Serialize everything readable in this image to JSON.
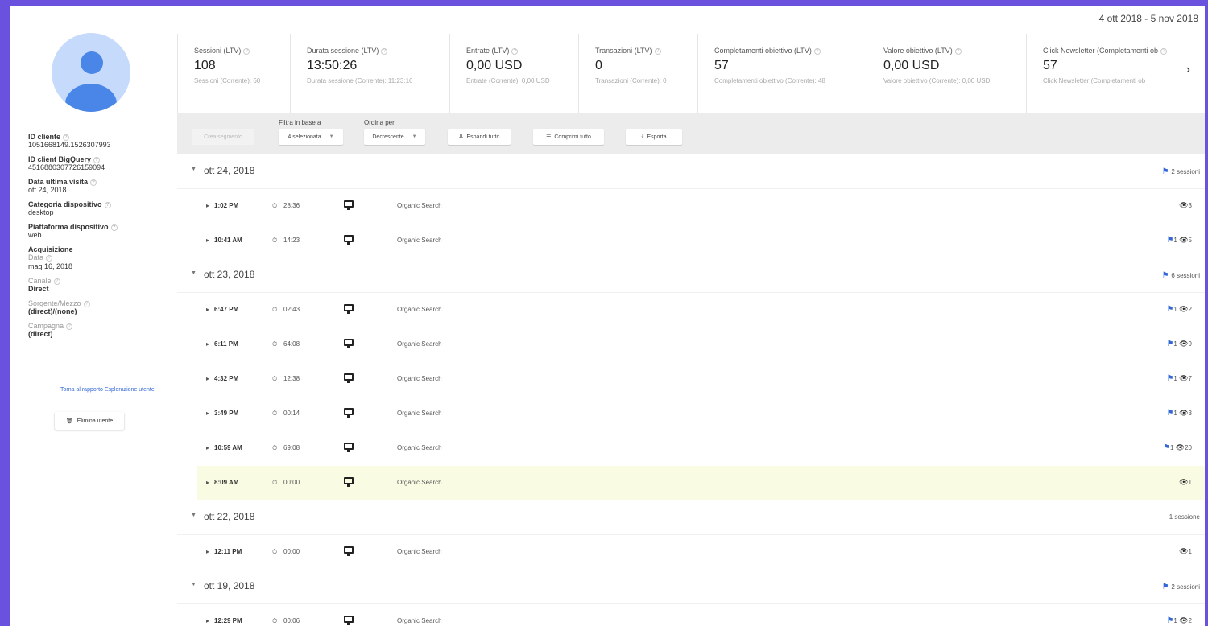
{
  "date_range": "4 ott 2018 - 5 nov 2018",
  "sidebar": {
    "fields": [
      {
        "label": "ID cliente",
        "value": "1051668149.1526307993"
      },
      {
        "label": "ID client BigQuery",
        "value": "4516880307726159094"
      },
      {
        "label": "Data ultima visita",
        "value": "ott 24, 2018"
      },
      {
        "label": "Categoria dispositivo",
        "value": "desktop"
      },
      {
        "label": "Piattaforma dispositivo",
        "value": "web"
      }
    ],
    "acquisition": {
      "label": "Acquisizione",
      "date_label": "Data",
      "date_value": "mag 16, 2018",
      "fields": [
        {
          "label": "Canale",
          "value": "Direct"
        },
        {
          "label": "Sorgente/Mezzo",
          "value": "(direct)/(none)"
        },
        {
          "label": "Campagna",
          "value": "(direct)"
        }
      ]
    },
    "back_link": "Torna al rapporto Esplorazione utente",
    "delete_button": "Elimina utente"
  },
  "metrics": [
    {
      "title": "Sessioni (LTV)",
      "value": "108",
      "sub": "Sessioni (Corrente): 60"
    },
    {
      "title": "Durata sessione (LTV)",
      "value": "13:50:26",
      "sub": "Durata sessione (Corrente): 11:23:16"
    },
    {
      "title": "Entrate (LTV)",
      "value": "0,00 USD",
      "sub": "Entrate (Corrente): 0,00 USD"
    },
    {
      "title": "Transazioni (LTV)",
      "value": "0",
      "sub": "Transazioni (Corrente): 0"
    },
    {
      "title": "Completamenti obiettivo (LTV)",
      "value": "57",
      "sub": "Completamenti obiettivo (Corrente): 48"
    },
    {
      "title": "Valore obiettivo (LTV)",
      "value": "0,00 USD",
      "sub": "Valore obiettivo (Corrente): 0,00 USD"
    },
    {
      "title": "Click Newsletter (Completamenti ob",
      "value": "57",
      "sub": "Click Newsletter (Completamenti ob"
    }
  ],
  "toolbar": {
    "segment_button": "Crea segmento",
    "filter_label": "Filtra in base a",
    "filter_value": "4 selezionata",
    "sort_label": "Ordina per",
    "sort_value": "Decrescente",
    "expand_all": "Espandi tutto",
    "collapse_all": "Comprimi tutto",
    "export": "Esporta"
  },
  "days": [
    {
      "date": "ott 24, 2018",
      "count": "2 sessioni",
      "flag": true,
      "sessions": [
        {
          "time": "1:02 PM",
          "duration": "28:36",
          "channel": "Organic Search",
          "goals": "",
          "views": "3",
          "hl": false
        },
        {
          "time": "10:41 AM",
          "duration": "14:23",
          "channel": "Organic Search",
          "goals": "1",
          "views": "5",
          "hl": false
        }
      ]
    },
    {
      "date": "ott 23, 2018",
      "count": "6 sessioni",
      "flag": true,
      "sessions": [
        {
          "time": "6:47 PM",
          "duration": "02:43",
          "channel": "Organic Search",
          "goals": "1",
          "views": "2",
          "hl": false
        },
        {
          "time": "6:11 PM",
          "duration": "64:08",
          "channel": "Organic Search",
          "goals": "1",
          "views": "9",
          "hl": false
        },
        {
          "time": "4:32 PM",
          "duration": "12:38",
          "channel": "Organic Search",
          "goals": "1",
          "views": "7",
          "hl": false
        },
        {
          "time": "3:49 PM",
          "duration": "00:14",
          "channel": "Organic Search",
          "goals": "1",
          "views": "3",
          "hl": false
        },
        {
          "time": "10:59 AM",
          "duration": "69:08",
          "channel": "Organic Search",
          "goals": "1",
          "views": "20",
          "hl": false
        },
        {
          "time": "8:09 AM",
          "duration": "00:00",
          "channel": "Organic Search",
          "goals": "",
          "views": "1",
          "hl": true
        }
      ]
    },
    {
      "date": "ott 22, 2018",
      "count": "1 sessione",
      "flag": false,
      "sessions": [
        {
          "time": "12:11 PM",
          "duration": "00:00",
          "channel": "Organic Search",
          "goals": "",
          "views": "1",
          "hl": false
        }
      ]
    },
    {
      "date": "ott 19, 2018",
      "count": "2 sessioni",
      "flag": true,
      "sessions": [
        {
          "time": "12:29 PM",
          "duration": "00:06",
          "channel": "Organic Search",
          "goals": "1",
          "views": "2",
          "hl": false
        }
      ]
    }
  ]
}
